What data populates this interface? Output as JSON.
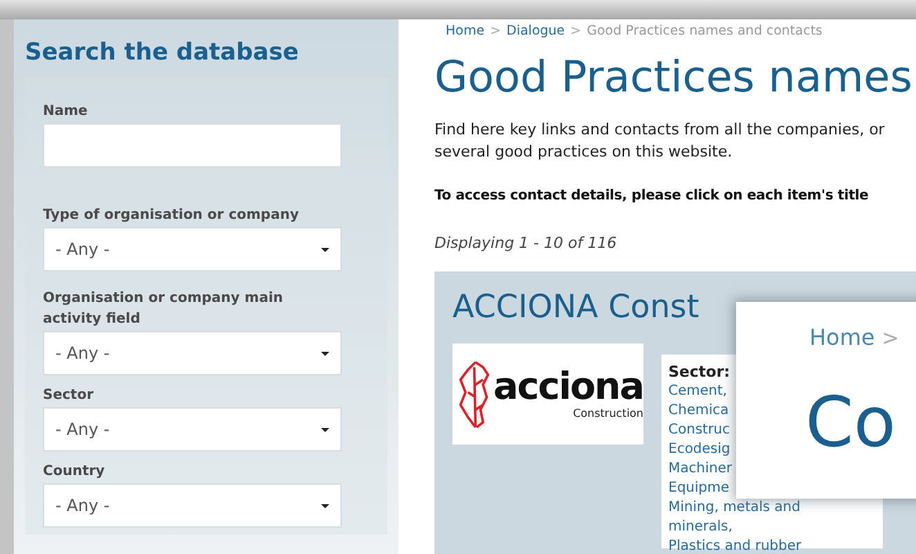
{
  "sidebar": {
    "title": "Search the database",
    "fields": [
      {
        "kind": "text",
        "label": "Name"
      },
      {
        "kind": "select",
        "label": "Type of organisation or company",
        "value": "- Any -"
      },
      {
        "kind": "select",
        "label": "Organisation or company main activity field",
        "value": "- Any -"
      },
      {
        "kind": "select",
        "label": "Sector",
        "value": "- Any -"
      },
      {
        "kind": "select",
        "label": "Country",
        "value": "- Any -"
      }
    ]
  },
  "breadcrumb": {
    "links": [
      "Home",
      "Dialogue"
    ],
    "separator": ">",
    "current": "Good Practices names and contacts"
  },
  "page_title": "Good Practices names",
  "intro_lines": [
    "Find here key links and contacts from all the companies, or",
    "several good practices on this website."
  ],
  "instruction": "To access contact details, please click on each item's title",
  "count": "Displaying 1 - 10 of 116",
  "card": {
    "title": "ACCIONA Const",
    "logo": {
      "name": "acciona",
      "subtitle": "Construction"
    },
    "sector_label": "Sector:",
    "sectors": [
      "Cement,",
      "Chemica",
      "Construc",
      "Ecodesig",
      "Machiner",
      "Equipme",
      "Mining, metals and",
      "minerals,",
      "Plastics and rubber"
    ]
  },
  "zoom_callout": {
    "breadcrumb": "Home",
    "separator": ">",
    "title": "Co"
  }
}
